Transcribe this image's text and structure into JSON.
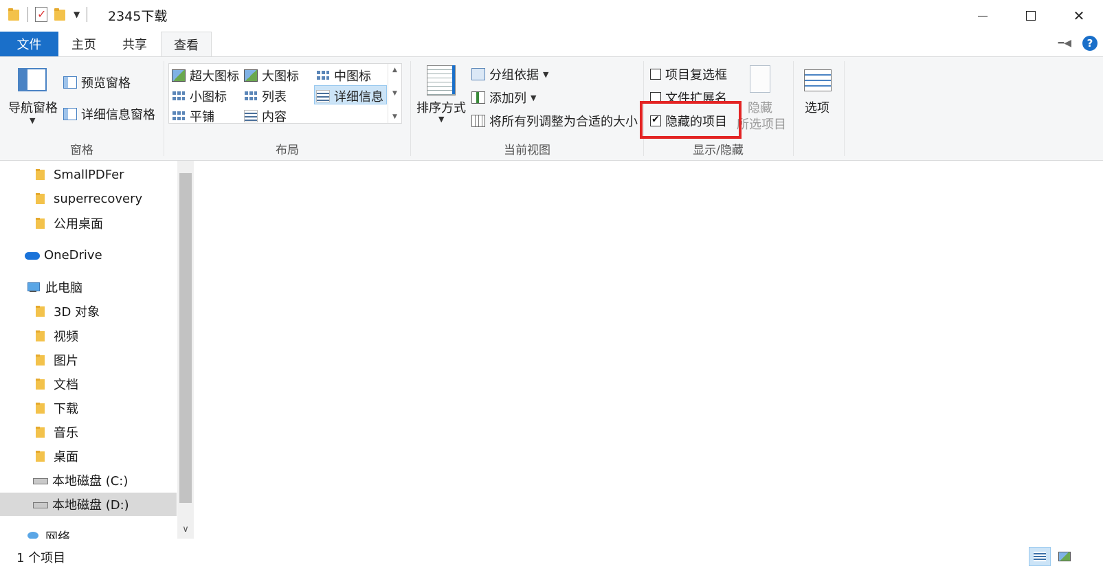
{
  "window": {
    "title": "2345下载"
  },
  "tabs": {
    "file": "文件",
    "home": "主页",
    "share": "共享",
    "view": "查看"
  },
  "ribbon": {
    "panes": {
      "label": "窗格",
      "nav_pane": "导航窗格",
      "preview_pane": "预览窗格",
      "details_pane": "详细信息窗格"
    },
    "layout": {
      "label": "布局",
      "options": [
        "超大图标",
        "大图标",
        "中图标",
        "小图标",
        "列表",
        "详细信息",
        "平铺",
        "内容"
      ],
      "selected": "详细信息"
    },
    "current_view": {
      "label": "当前视图",
      "sort_by": "排序方式",
      "group_by": "分组依据",
      "add_columns": "添加列",
      "size_all_columns": "将所有列调整为合适的大小"
    },
    "show_hide": {
      "label": "显示/隐藏",
      "item_checkboxes": "项目复选框",
      "item_checkboxes_checked": false,
      "file_extensions": "文件扩展名",
      "file_extensions_checked": false,
      "hidden_items": "隐藏的项目",
      "hidden_items_checked": true,
      "hide_selected_line1": "隐藏",
      "hide_selected_line2": "所选项目"
    },
    "options": {
      "label": "选项"
    }
  },
  "nav_pane": {
    "items": [
      {
        "label": "SmallPDFer",
        "icon": "folder-icon"
      },
      {
        "label": "superrecovery",
        "icon": "folder-icon"
      },
      {
        "label": "公用桌面",
        "icon": "folder-icon"
      },
      {
        "label": "OneDrive",
        "icon": "onedrive-icon"
      },
      {
        "label": "此电脑",
        "icon": "computer-icon"
      },
      {
        "label": "3D 对象",
        "icon": "folder-3d-icon"
      },
      {
        "label": "视频",
        "icon": "folder-video-icon"
      },
      {
        "label": "图片",
        "icon": "folder-pictures-icon"
      },
      {
        "label": "文档",
        "icon": "folder-documents-icon"
      },
      {
        "label": "下载",
        "icon": "folder-downloads-icon"
      },
      {
        "label": "音乐",
        "icon": "folder-music-icon"
      },
      {
        "label": "桌面",
        "icon": "folder-desktop-icon"
      },
      {
        "label": "本地磁盘 (C:)",
        "icon": "drive-c-icon"
      },
      {
        "label": "本地磁盘 (D:)",
        "icon": "drive-d-icon"
      },
      {
        "label": "网络",
        "icon": "network-icon"
      }
    ],
    "selected": "本地磁盘 (D:)"
  },
  "status": {
    "item_count": "1 个项目"
  },
  "colors": {
    "accent": "#1a6fc9",
    "highlight_box": "#e32424",
    "selection": "#cce4f7"
  }
}
